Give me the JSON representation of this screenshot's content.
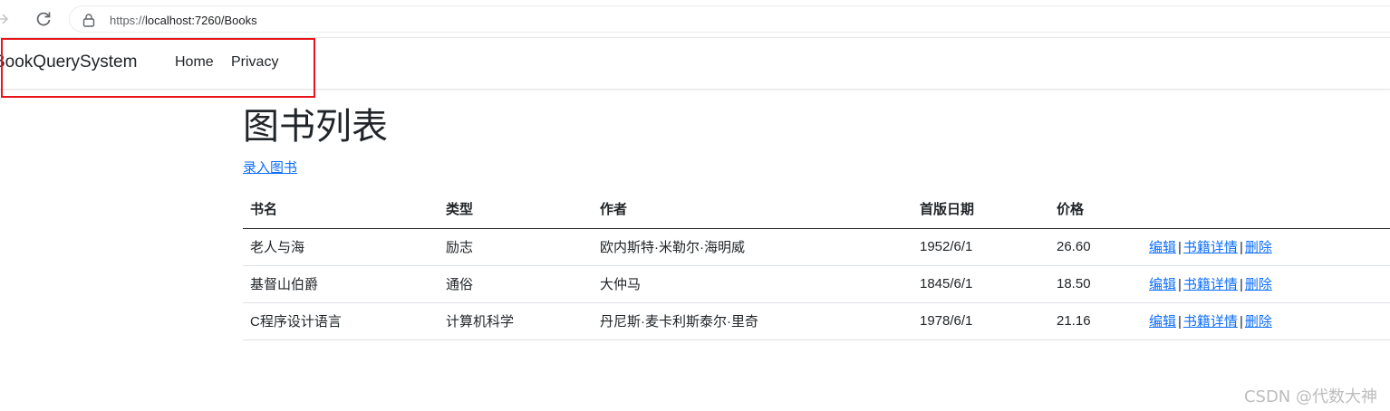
{
  "browser": {
    "url_scheme": "https://",
    "url_rest": "localhost:7260/Books"
  },
  "navbar": {
    "brand": "BookQuerySystem",
    "links": [
      "Home",
      "Privacy"
    ]
  },
  "page": {
    "title": "图书列表",
    "create_link": "录入图书"
  },
  "table": {
    "headers": [
      "书名",
      "类型",
      "作者",
      "首版日期",
      "价格"
    ],
    "rows": [
      [
        "老人与海",
        "励志",
        "欧内斯特·米勒尔·海明威",
        "1952/6/1",
        "26.60"
      ],
      [
        "基督山伯爵",
        "通俗",
        "大仲马",
        "1845/6/1",
        "18.50"
      ],
      [
        "C程序设计语言",
        "计算机科学",
        "丹尼斯·麦卡利斯泰尔·里奇",
        "1978/6/1",
        "21.16"
      ]
    ],
    "actions": [
      "编辑",
      "书籍详情",
      "删除"
    ],
    "action_separator": "|"
  },
  "watermark": "CSDN @代数大神",
  "colors": {
    "link": "#0d6efd",
    "highlight": "#e8141b"
  }
}
